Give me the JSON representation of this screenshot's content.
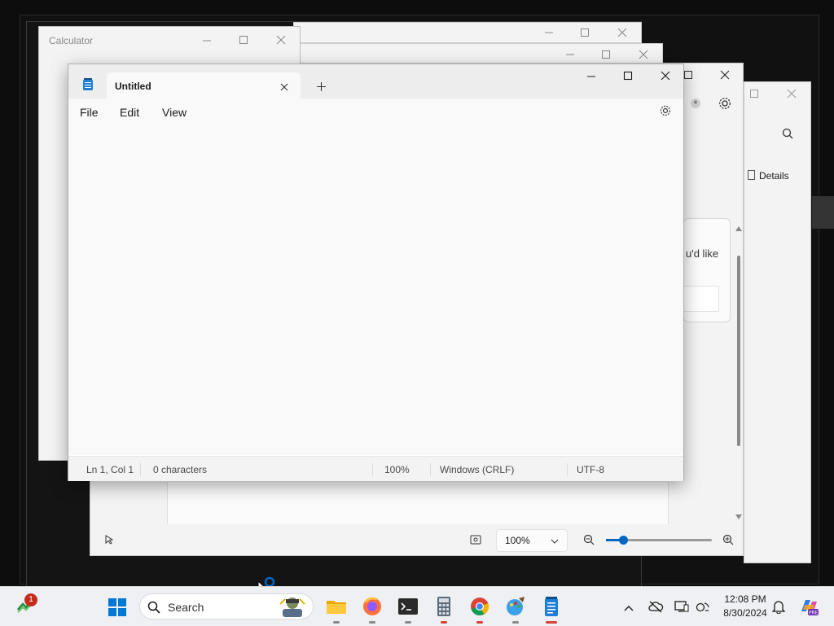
{
  "calculator": {
    "title": "Calculator"
  },
  "notepad": {
    "tab_title": "Untitled",
    "menu": {
      "file": "File",
      "edit": "Edit",
      "view": "View"
    },
    "status": {
      "position": "Ln 1, Col 1",
      "characters": "0 characters",
      "zoom": "100%",
      "line_ending": "Windows (CRLF)",
      "encoding": "UTF-8"
    }
  },
  "background_window": {
    "details_label": "Details",
    "partial_text": "u'd like",
    "zoom_value": "100%"
  },
  "taskbar": {
    "search_placeholder": "Search",
    "notification_badge": "1",
    "time": "12:08 PM",
    "date": "8/30/2024",
    "apps": [
      "file-explorer-icon",
      "firefox-icon",
      "terminal-icon",
      "calculator-icon",
      "chrome-icon",
      "paint-icon",
      "notepad-icon"
    ]
  },
  "colors": {
    "accent": "#0067c0",
    "taskbar_bg": "#eef0f3",
    "indicator_active": "#d8413a",
    "indicator_inactive": "#8a8a8a"
  }
}
